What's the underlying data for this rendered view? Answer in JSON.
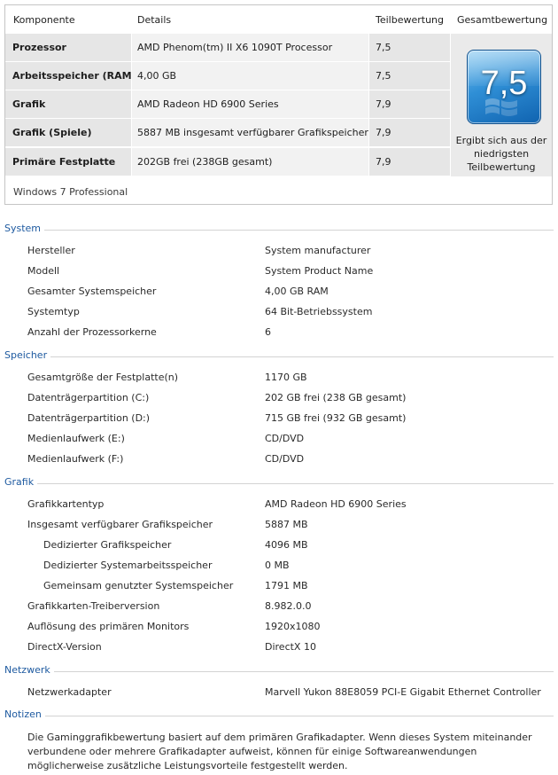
{
  "score_table": {
    "headers": {
      "komponente": "Komponente",
      "details": "Details",
      "teilbewertung": "Teilbewertung",
      "gesamtbewertung": "Gesamtbewertung"
    },
    "rows": [
      {
        "name": "Prozessor",
        "details": "AMD Phenom(tm) II X6 1090T Processor",
        "score": "7,5"
      },
      {
        "name": "Arbeitsspeicher (RAM)",
        "details": "4,00 GB",
        "score": "7,5"
      },
      {
        "name": "Grafik",
        "details": "AMD Radeon HD 6900 Series",
        "score": "7,9"
      },
      {
        "name": "Grafik (Spiele)",
        "details": "5887 MB insgesamt verfügbarer Grafikspeicher",
        "score": "7,9"
      },
      {
        "name": "Primäre Festplatte",
        "details": "202GB frei (238GB gesamt)",
        "score": "7,9"
      }
    ],
    "base_score": "7,5",
    "base_score_note": "Ergibt sich aus der niedrigsten Teilbewertung",
    "edition": "Windows 7 Professional"
  },
  "sections": {
    "system": {
      "title": "System",
      "items": [
        {
          "label": "Hersteller",
          "value": "System manufacturer"
        },
        {
          "label": "Modell",
          "value": "System Product Name"
        },
        {
          "label": "Gesamter Systemspeicher",
          "value": "4,00 GB RAM"
        },
        {
          "label": "Systemtyp",
          "value": "64 Bit-Betriebssystem"
        },
        {
          "label": "Anzahl der Prozessorkerne",
          "value": "6"
        }
      ]
    },
    "speicher": {
      "title": "Speicher",
      "items": [
        {
          "label": "Gesamtgröße der Festplatte(n)",
          "value": "1170 GB"
        },
        {
          "label": "Datenträgerpartition (C:)",
          "value": "202 GB frei (238 GB gesamt)"
        },
        {
          "label": "Datenträgerpartition (D:)",
          "value": "715 GB frei (932 GB gesamt)"
        },
        {
          "label": "Medienlaufwerk (E:)",
          "value": "CD/DVD"
        },
        {
          "label": "Medienlaufwerk (F:)",
          "value": "CD/DVD"
        }
      ]
    },
    "grafik": {
      "title": "Grafik",
      "items": [
        {
          "label": "Grafikkartentyp",
          "value": "AMD Radeon HD 6900 Series"
        },
        {
          "label": "Insgesamt verfügbarer Grafikspeicher",
          "value": "5887 MB"
        },
        {
          "label": "Dedizierter Grafikspeicher",
          "value": "4096 MB"
        },
        {
          "label": "Dedizierter Systemarbeitsspeicher",
          "value": "0 MB"
        },
        {
          "label": "Gemeinsam genutzter Systemspeicher",
          "value": "1791 MB"
        },
        {
          "label": "Grafikkarten-Treiberversion",
          "value": "8.982.0.0"
        },
        {
          "label": "Auflösung des primären Monitors",
          "value": "1920x1080"
        },
        {
          "label": "DirectX-Version",
          "value": "DirectX 10"
        }
      ]
    },
    "netzwerk": {
      "title": "Netzwerk",
      "items": [
        {
          "label": "Netzwerkadapter",
          "value": "Marvell Yukon 88E8059 PCI-E Gigabit Ethernet Controller"
        }
      ]
    },
    "notizen": {
      "title": "Notizen",
      "text": "Die Gaminggrafikbewertung basiert auf dem primären Grafikadapter. Wenn dieses System miteinander verbundene oder mehrere Grafikadapter aufweist, können für einige Softwareanwendungen möglicherweise zusätzliche Leistungsvorteile festgestellt werden."
    }
  },
  "colors": {
    "section_title": "#1e5aa0",
    "badge": "#2f8fd6"
  },
  "icons": {
    "badge": "windows-experience-index-badge-icon"
  }
}
